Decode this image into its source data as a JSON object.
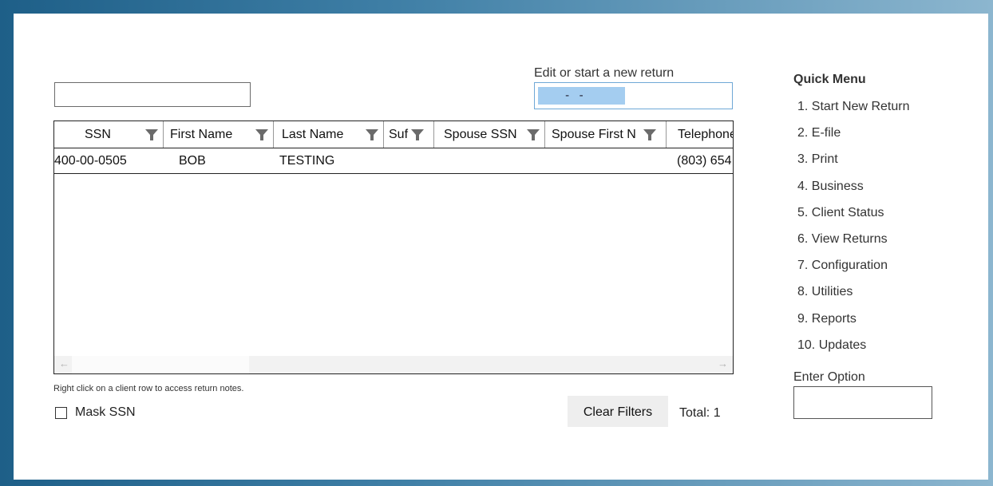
{
  "search": {
    "value": ""
  },
  "edit_return": {
    "label": "Edit or start a new return",
    "ssn_mask": " -   - "
  },
  "grid": {
    "columns": [
      {
        "label": "SSN"
      },
      {
        "label": "First Name"
      },
      {
        "label": "Last Name"
      },
      {
        "label": "Suf"
      },
      {
        "label": "Spouse SSN"
      },
      {
        "label": "Spouse First N"
      },
      {
        "label": "Telephone"
      }
    ],
    "rows": [
      {
        "ssn": "400-00-0505",
        "first_name": "BOB",
        "last_name": "TESTING",
        "suffix": "",
        "spouse_ssn": "",
        "spouse_first": "",
        "telephone": "(803) 654"
      }
    ],
    "scroll_left_icon": "chevron-left-icon",
    "scroll_right_icon": "chevron-right-icon"
  },
  "note": "Right click on a client row to access return notes.",
  "mask_ssn": {
    "label": "Mask SSN",
    "checked": false
  },
  "clear_filters_label": "Clear Filters",
  "total_label": "Total: 1",
  "quick_menu": {
    "title": "Quick Menu",
    "items": [
      "1. Start New Return",
      "2. E-file",
      "3. Print",
      "4. Business",
      "5. Client Status",
      "6. View Returns",
      "7. Configuration",
      "8. Utilities",
      "9. Reports",
      "10. Updates"
    ]
  },
  "enter_option": {
    "label": "Enter Option",
    "value": ""
  },
  "colors": {
    "accent": "#a4cdf0",
    "frame": "#1e5f88"
  }
}
